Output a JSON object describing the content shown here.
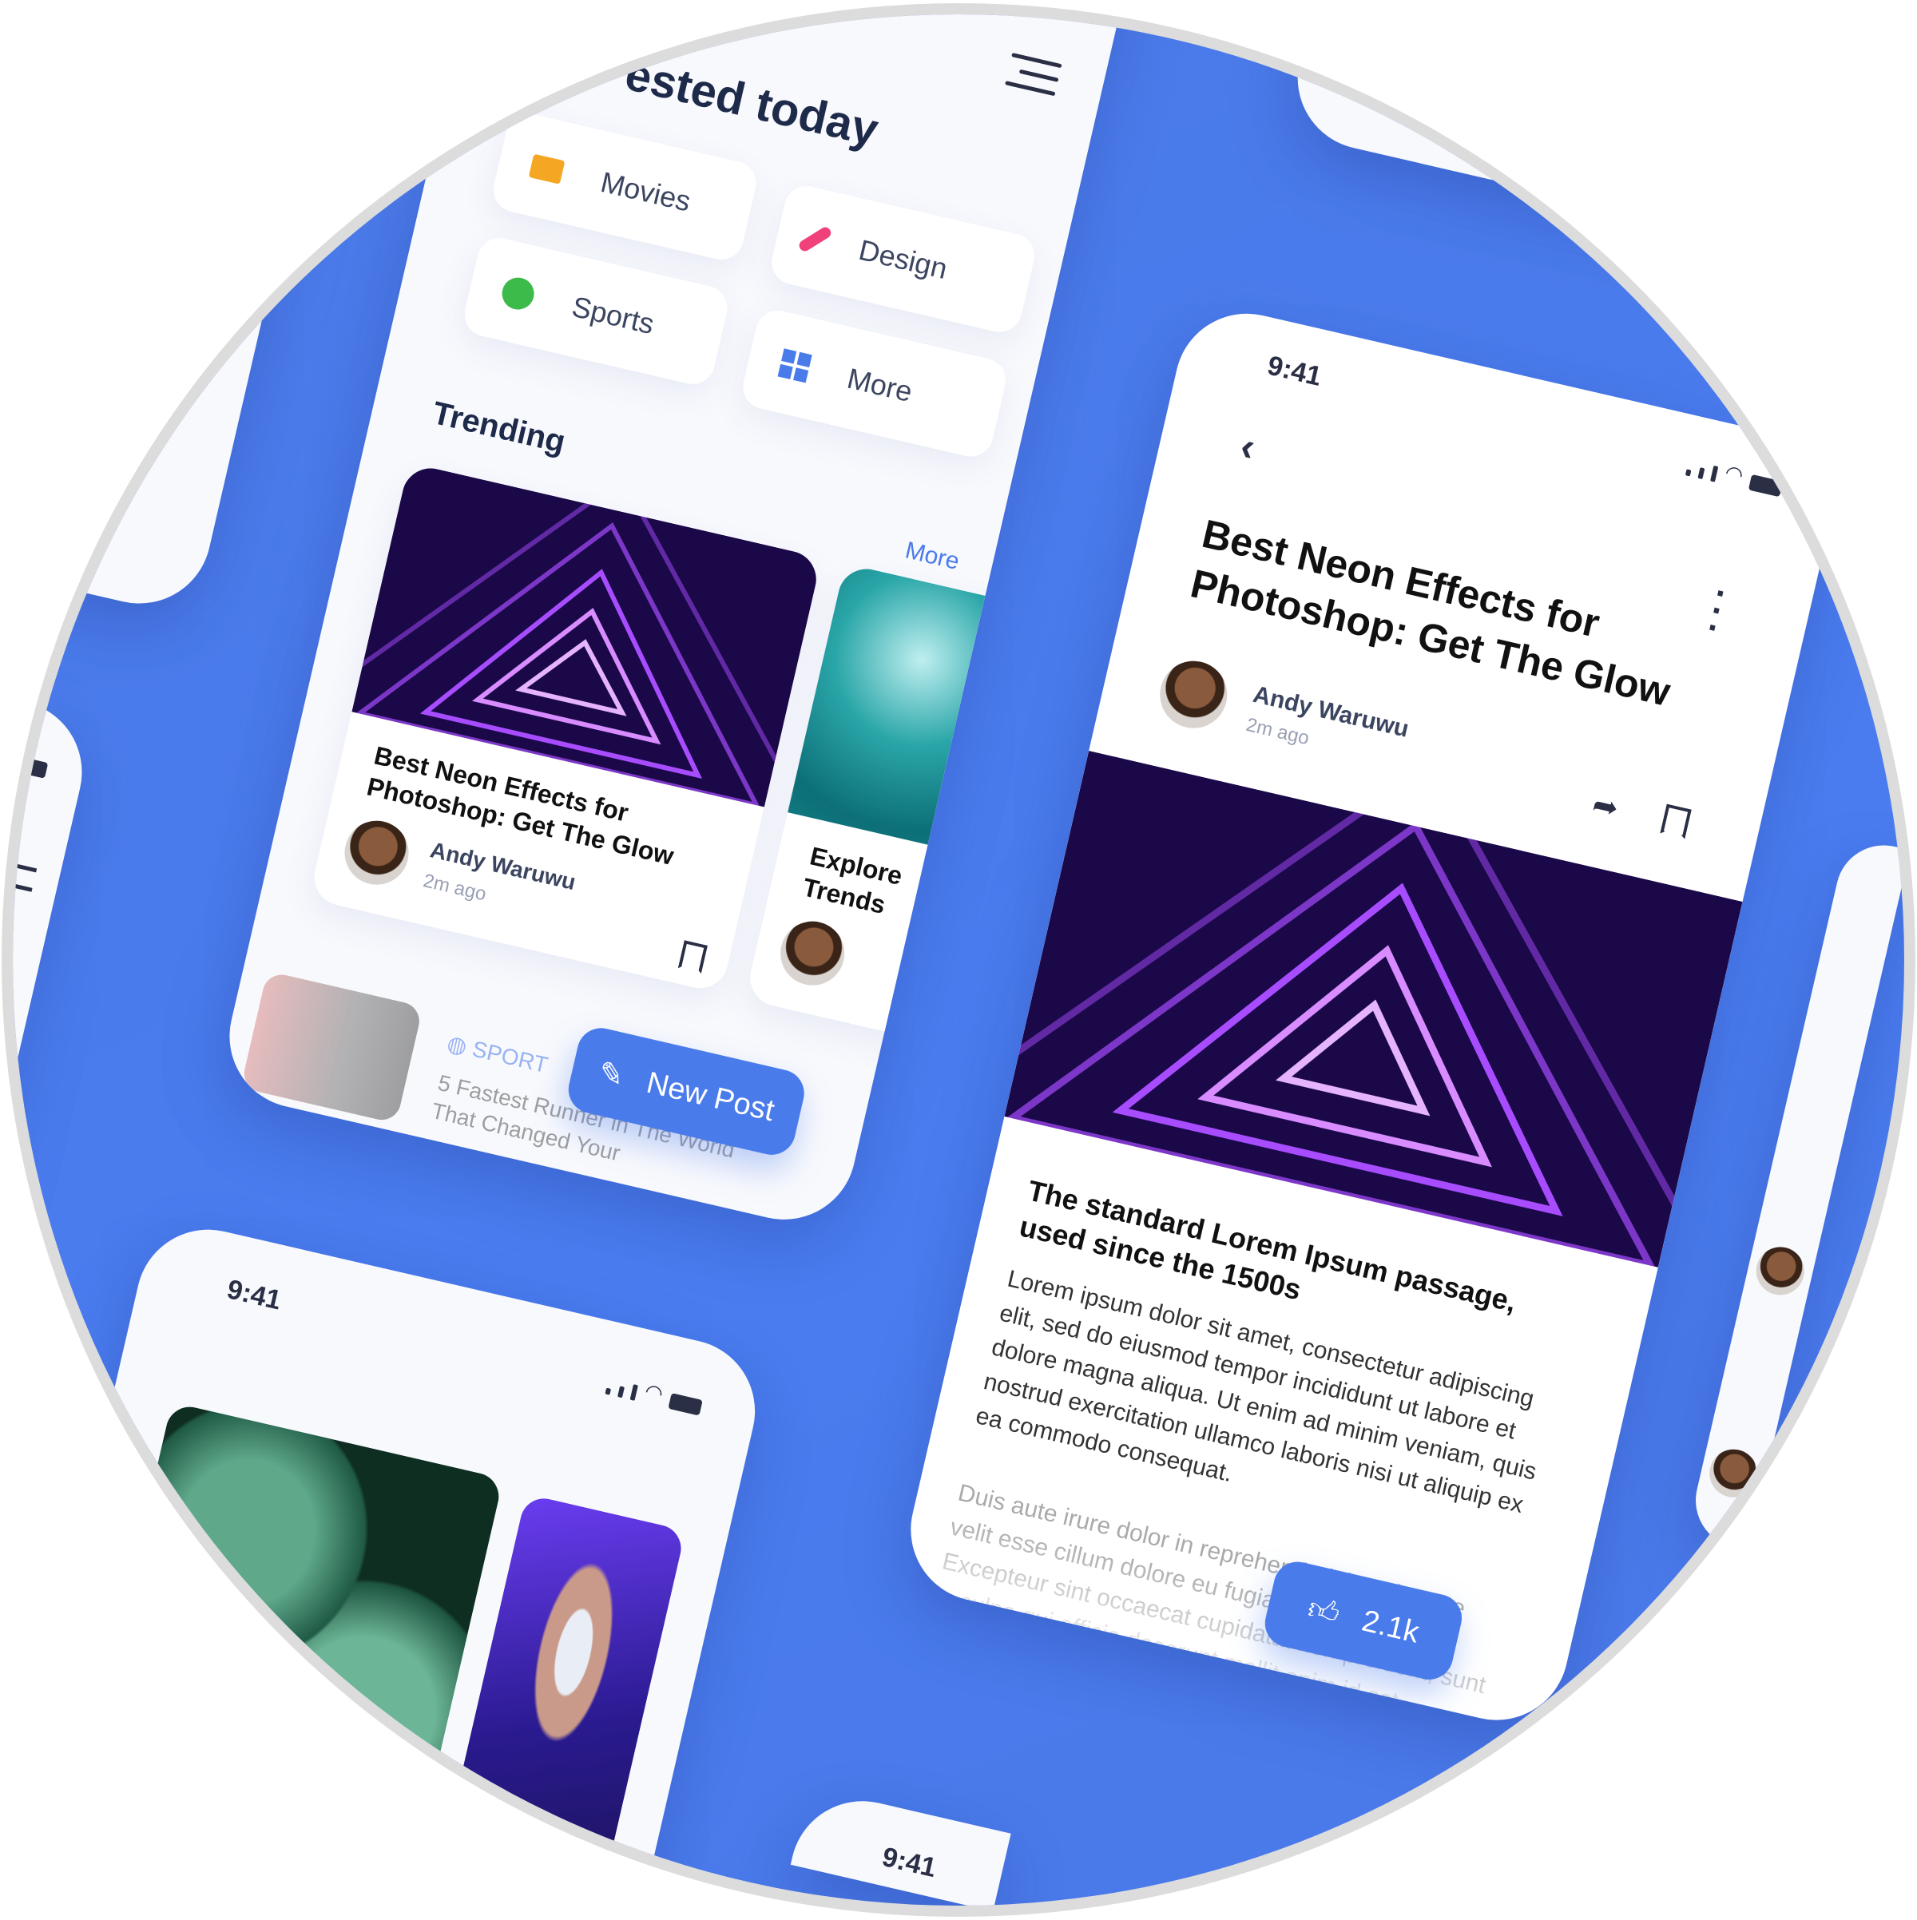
{
  "feed": {
    "title": "ested today",
    "categories": [
      {
        "label": "Movies",
        "icon": "video-camera-icon",
        "color": "#f5a623"
      },
      {
        "label": "Design",
        "icon": "brush-icon",
        "color": "#f0417a"
      },
      {
        "label": "Sports",
        "icon": "ball-icon",
        "color": "#3dbb4a"
      },
      {
        "label": "More",
        "icon": "grid-icon",
        "color": "#4a7bea"
      }
    ],
    "trending_label": "Trending",
    "more_link": "More",
    "cards": [
      {
        "title": "Best Neon Effects for Photoshop: Get The Glow",
        "author": "Andy Waruwu",
        "time": "2m ago"
      },
      {
        "title": "Explore Trends"
      }
    ],
    "list_item": {
      "category": "SPORT",
      "title": "5 Fastest Runner in The World That Changed Your"
    },
    "new_post": "New Post"
  },
  "detail": {
    "time": "9:41",
    "title": "Best Neon Effects for Photoshop: Get The Glow",
    "author": "Andy Waruwu",
    "time_ago": "2m ago",
    "subtitle": "The standard Lorem Ipsum passage, used since the 1500s",
    "paragraph1": "Lorem ipsum dolor sit amet, consectetur adipiscing elit, sed do eiusmod tempor incididunt ut labore et dolore magna aliqua. Ut enim ad minim veniam, quis nostrud exercitation ullamco laboris nisi ut aliquip ex ea commodo consequat.",
    "paragraph2": "Duis aute irure dolor in reprehenderit in voluptate velit esse cillum dolore eu fugiat nulla pariatur. Excepteur sint occaecat cupidatat non proident, sunt in culpa qui officia deserunt mollit anim id est laborum.",
    "likes": "2.1k"
  },
  "gallery": {
    "time": "9:41"
  },
  "bottom_phone": {
    "time": "9:41"
  },
  "colors": {
    "accent": "#4a7bea",
    "background": "#4a7bea"
  }
}
